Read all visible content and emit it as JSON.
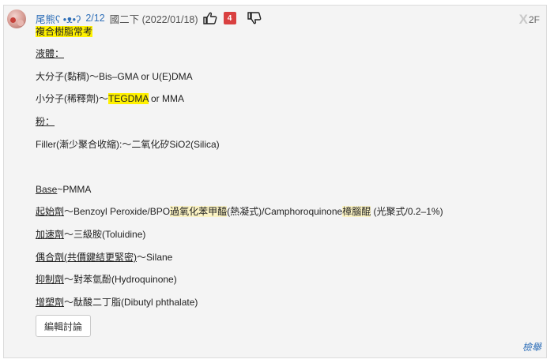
{
  "post": {
    "username": "尾熊ʕ •ᴥ•ʔ",
    "score": "2/12",
    "meta": "國二下 (2022/01/18)",
    "like_count": "4",
    "floor_mark": "X",
    "floor_number": "2F"
  },
  "body": {
    "title": "複合樹脂常考",
    "liquid_heading": "液體：",
    "large_molecule": "大分子(黏稠)～Bis–GMA or U(E)DMA",
    "small_molecule_prefix": "小分子(稀釋劑)～",
    "small_molecule_hl": "TEGDMA",
    "small_molecule_suffix": " or MMA",
    "powder_heading": "粉：",
    "filler": "Filler(漸少聚合收縮):～二氧化矽SiO2(Silica)",
    "base_label": "Base",
    "base_rest": "~PMMA",
    "initiator_label": "起始劑",
    "initiator_part1": "～Benzoyl Peroxide/BPO",
    "initiator_hl1": "過氧化苯甲醯",
    "initiator_part2": "(熱凝式)/Camphoroquinone",
    "initiator_hl2": "樟腦醌",
    "initiator_part3": " (光聚式/0.2–1%)",
    "accelerator_label": "加速劑",
    "accelerator_rest": "～三級胺(Toluidine)",
    "coupling_label": "偶合劑(共價鍵結更緊密)",
    "coupling_rest": "～Silane",
    "inhibitor_label": "抑制劑",
    "inhibitor_rest": "～對苯氫酚(Hydroquinone)",
    "plasticizer_label": "增塑劑",
    "plasticizer_rest": "～酞酸二丁脂(Dibutyl phthalate)"
  },
  "actions": {
    "edit_label": "編輯討論",
    "report_label": "檢舉"
  },
  "icons": {
    "like": "thumbs-up-icon",
    "dislike": "thumbs-down-icon"
  },
  "colors": {
    "link": "#2f6fb8",
    "highlight": "#fff100",
    "badge": "#d94040"
  }
}
